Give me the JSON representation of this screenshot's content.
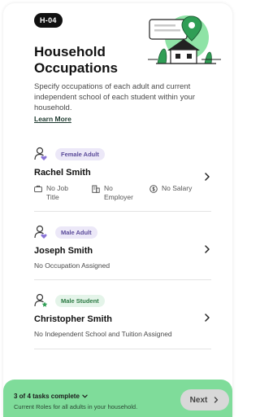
{
  "header": {
    "badge": "H-04",
    "title": "Household Occupations",
    "description": "Specify occupations of each adult and current independent school of each student within your household.",
    "learn_more": "Learn More"
  },
  "people": [
    {
      "tag": "Female Adult",
      "name": "Rachel Smith",
      "details": {
        "job": "No Job Title",
        "employer": "No Employer",
        "salary": "No Salary"
      }
    },
    {
      "tag": "Male Adult",
      "name": "Joseph Smith",
      "note": "No Occupation Assigned"
    },
    {
      "tag": "Male Student",
      "name": "Christopher Smith",
      "note": "No Independent School and Tuition Assigned"
    }
  ],
  "footer": {
    "status": "3 of 4 tasks complete",
    "subtitle": "Current Roles for all adults in your household.",
    "next_label": "Next"
  },
  "colors": {
    "accent_green": "#7fdc9a",
    "tag_purple_bg": "#ece8f8",
    "tag_green_bg": "#e4f4e9"
  }
}
